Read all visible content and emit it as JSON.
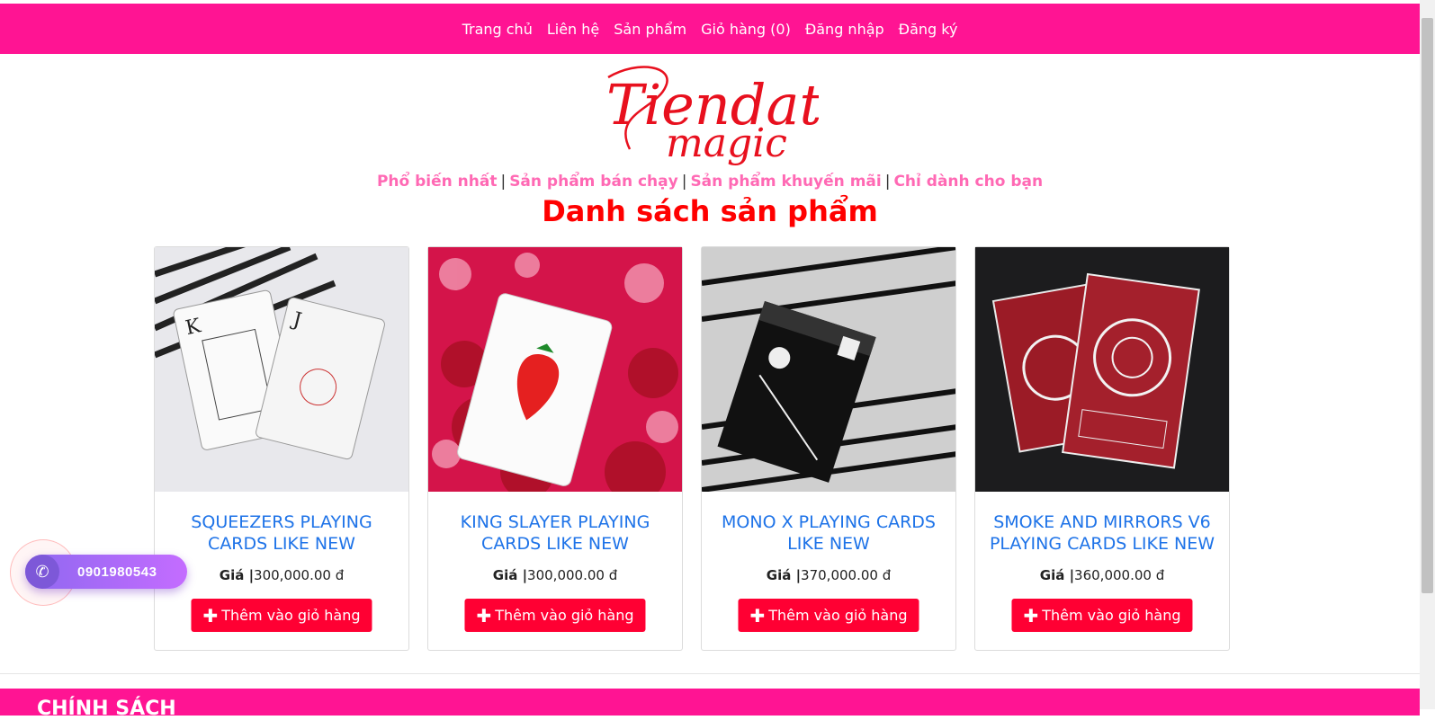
{
  "nav": {
    "items": [
      "Trang chủ",
      "Liên hệ",
      "Sản phẩm",
      "Giỏ hàng (0)",
      "Đăng nhập",
      "Đăng ký"
    ]
  },
  "logo": {
    "line1": "Tiendat",
    "line2": "magic"
  },
  "subnav": {
    "items": [
      "Phổ biến nhất",
      "Sản phẩm bán chạy",
      "Sản phẩm khuyến mãi",
      "Chỉ dành cho bạn"
    ],
    "separator": "|"
  },
  "heading": "Danh sách sản phẩm",
  "products": [
    {
      "title": "SQUEEZERS PLAYING CARDS LIKE NEW",
      "price_label": "Giá |",
      "price": "300,000.00 đ",
      "button": "Thêm vào giỏ hàng"
    },
    {
      "title": "KING SLAYER PLAYING CARDS LIKE NEW",
      "price_label": "Giá |",
      "price": "300,000.00 đ",
      "button": "Thêm vào giỏ hàng"
    },
    {
      "title": "MONO X PLAYING CARDS LIKE NEW",
      "price_label": "Giá |",
      "price": "370,000.00 đ",
      "button": "Thêm vào giỏ hàng"
    },
    {
      "title": "SMOKE AND MIRRORS V6 PLAYING CARDS LIKE NEW",
      "price_label": "Giá |",
      "price": "360,000.00 đ",
      "button": "Thêm vào giỏ hàng"
    }
  ],
  "phone": {
    "number": "0901980543",
    "icon": "phone-icon"
  },
  "footer": {
    "title": "CHÍNH SÁCH"
  },
  "colors": {
    "brand": "#ff1493",
    "accent": "#ff0033",
    "title_blue": "#1e73e8",
    "heading_red": "#ff0000",
    "subnav_pink": "#ff69b4"
  }
}
